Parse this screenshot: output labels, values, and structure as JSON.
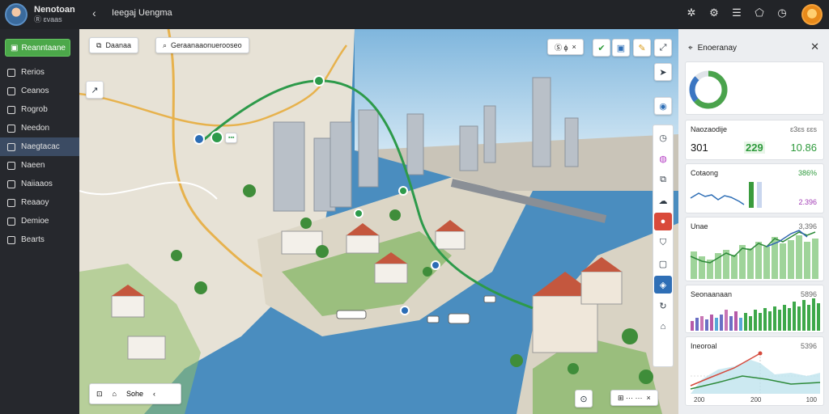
{
  "user": {
    "name": "Nenotoan",
    "status": "Ⓡ ɛvaas"
  },
  "topbar": {
    "back": "‹",
    "title": "Ieegaj Uengma",
    "icons": [
      "settings-icon",
      "grid-icon",
      "list-icon",
      "pentagon-icon",
      "clock-icon"
    ]
  },
  "sidebar": {
    "primary_button": "Reanntaane",
    "items": [
      {
        "label": "Rerios",
        "icon": "doc-icon",
        "active": false
      },
      {
        "label": "Ceanos",
        "icon": "file-icon",
        "active": false
      },
      {
        "label": "Rogrob",
        "icon": "folder-icon",
        "active": false
      },
      {
        "label": "Needon",
        "icon": "tag-icon",
        "active": false
      },
      {
        "label": "Naegtacac",
        "icon": "car-icon",
        "active": true
      },
      {
        "label": "Naeen",
        "icon": "person-icon",
        "active": false
      },
      {
        "label": "Naiiaaos",
        "icon": "gear-icon",
        "active": false
      },
      {
        "label": "Reaaoy",
        "icon": "grid-icon",
        "active": false
      },
      {
        "label": "Demioe",
        "icon": "doc-icon",
        "active": false
      },
      {
        "label": "Bearts",
        "icon": "box-icon",
        "active": false
      }
    ]
  },
  "map": {
    "chip_left": "Daanaa",
    "chip_center": "Geraanaaonuerooseo",
    "chip_right": "Ⓢ ϕ",
    "marker_label": "▪▪▪",
    "bottom_bar": [
      "⊡",
      "⌂",
      "Sohe",
      "‹"
    ],
    "zoom_chip": "⊞ ··· ···",
    "bottom_small": "⊙"
  },
  "panel": {
    "title": "Enoeranay",
    "cards": [
      {
        "title": "Naozaodije",
        "delta": "ɛ3ɛs ɛɛs",
        "values": [
          "301",
          "229",
          "10.86"
        ]
      },
      {
        "title": "Cotaong",
        "delta": "386%",
        "value": "2.396"
      },
      {
        "title": "Unae",
        "delta": "3,396"
      },
      {
        "title": "Seonaanaan",
        "delta": "5896"
      },
      {
        "title": "Ineoroal",
        "delta": "5396",
        "axis": [
          "200",
          "200",
          "100"
        ]
      }
    ]
  }
}
